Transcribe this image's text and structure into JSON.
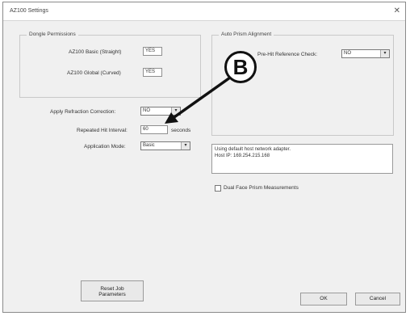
{
  "window": {
    "title": "AZ100 Settings",
    "close_glyph": "✕"
  },
  "dongle": {
    "legend": "Dongle Permissions",
    "basic_label": "AZ100 Basic (Straight)",
    "basic_value": "YES",
    "global_label": "AZ100 Global (Curved)",
    "global_value": "YES"
  },
  "prism": {
    "legend": "Auto Prism Alignment",
    "check_label": "Pre-Hit Reference Check:",
    "check_value": "NO"
  },
  "settings": {
    "refraction_label": "Apply Refraction Correction:",
    "refraction_value": "NO",
    "interval_label": "Repeated Hit Interval:",
    "interval_value": "60",
    "interval_unit": "seconds",
    "mode_label": "Application Mode:",
    "mode_value": "Basic"
  },
  "network": {
    "line1": "Using default host network adapter.",
    "line2": "Host IP: 169.254.215.168"
  },
  "dual_face": {
    "label": "Dual Face Prism Measurements"
  },
  "buttons": {
    "reset": "Reset Job Parameters",
    "ok": "OK",
    "cancel": "Cancel"
  },
  "callout": {
    "letter": "B"
  },
  "icons": {
    "dropdown": "▾"
  }
}
